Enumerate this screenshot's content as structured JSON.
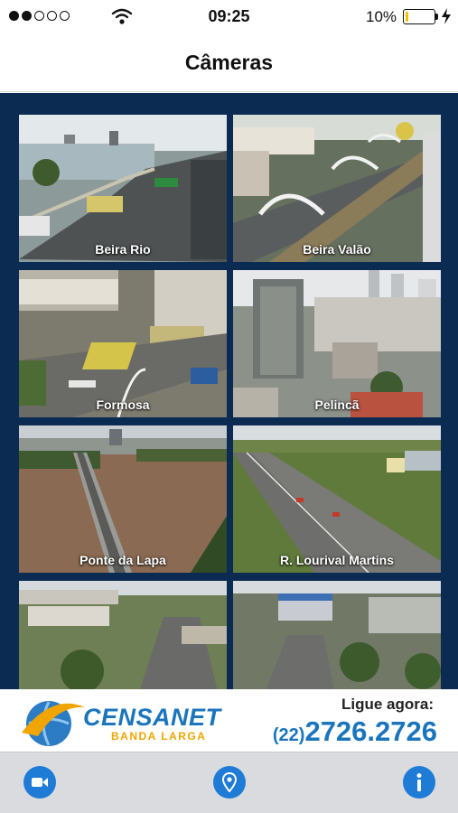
{
  "status_bar": {
    "time": "09:25",
    "battery_percent_label": "10%",
    "battery_level": 0.1,
    "signal_bars_filled": 2,
    "signal_bars_total": 5
  },
  "nav": {
    "title": "Câmeras"
  },
  "cameras": [
    {
      "label": "Beira Rio"
    },
    {
      "label": "Beira Valão"
    },
    {
      "label": "Formosa"
    },
    {
      "label": "Pelincã"
    },
    {
      "label": "Ponte da Lapa"
    },
    {
      "label": "R. Lourival Martins"
    },
    {
      "label": ""
    },
    {
      "label": ""
    }
  ],
  "ad": {
    "brand": "CENSANET",
    "tagline": "BANDA LARGA",
    "cta": "Ligue agora:",
    "phone_area": "(22)",
    "phone_number": "2726.2726"
  },
  "tabs": [
    {
      "icon": "video-camera-icon"
    },
    {
      "icon": "map-pin-icon"
    },
    {
      "icon": "info-icon"
    }
  ],
  "colors": {
    "grid_background": "#0c2b53",
    "accent_blue": "#1e7bd6",
    "brand_blue": "#1b75bc",
    "brand_orange": "#f0a500",
    "battery_yellow": "#f2c200"
  }
}
